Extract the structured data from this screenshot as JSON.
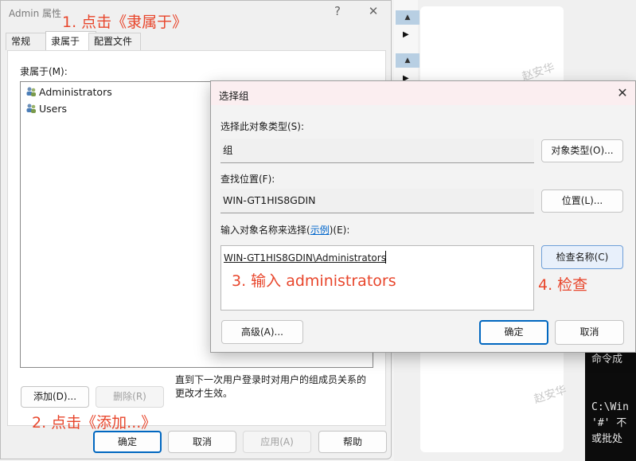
{
  "properties_window": {
    "title": "Admin 属性",
    "help_glyph": "?",
    "close_glyph": "✕",
    "tabs": [
      "常规",
      "隶属于",
      "配置文件"
    ],
    "members_label": "隶属于(M):",
    "members": [
      "Administrators",
      "Users"
    ],
    "note": "直到下一次用户登录时对用户的组成员关系的更改才生效。",
    "add_button": "添加(D)...",
    "remove_button": "删除(R)",
    "footer": {
      "ok": "确定",
      "cancel": "取消",
      "apply": "应用(A)",
      "help": "帮助"
    }
  },
  "select_group_dialog": {
    "title": "选择组",
    "close_glyph": "✕",
    "object_type_label": "选择此对象类型(S):",
    "object_type_value": "组",
    "object_types_button": "对象类型(O)...",
    "location_label": "查找位置(F):",
    "location_value": "WIN-GT1HIS8GDIN",
    "locations_button": "位置(L)...",
    "enter_label_prefix": "输入对象名称来选择(",
    "enter_label_link": "示例",
    "enter_label_suffix": ")(E):",
    "object_name_value": "WIN-GT1HIS8GDIN\\Administrators",
    "check_names_button": "检查名称(C)",
    "advanced_button": "高级(A)...",
    "ok_button": "确定",
    "cancel_button": "取消"
  },
  "annotations": {
    "step1": "1. 点击《隶属于》",
    "step2": "2. 点击《添加...》",
    "step3": "3. 输入 administrators",
    "step4": "4. 检查",
    "color": "#e8462c"
  },
  "background": {
    "watermark": "赵安华",
    "console_lines": [
      "命令成",
      "",
      "C:\\Win",
      "'#' 不",
      "或批处"
    ]
  }
}
